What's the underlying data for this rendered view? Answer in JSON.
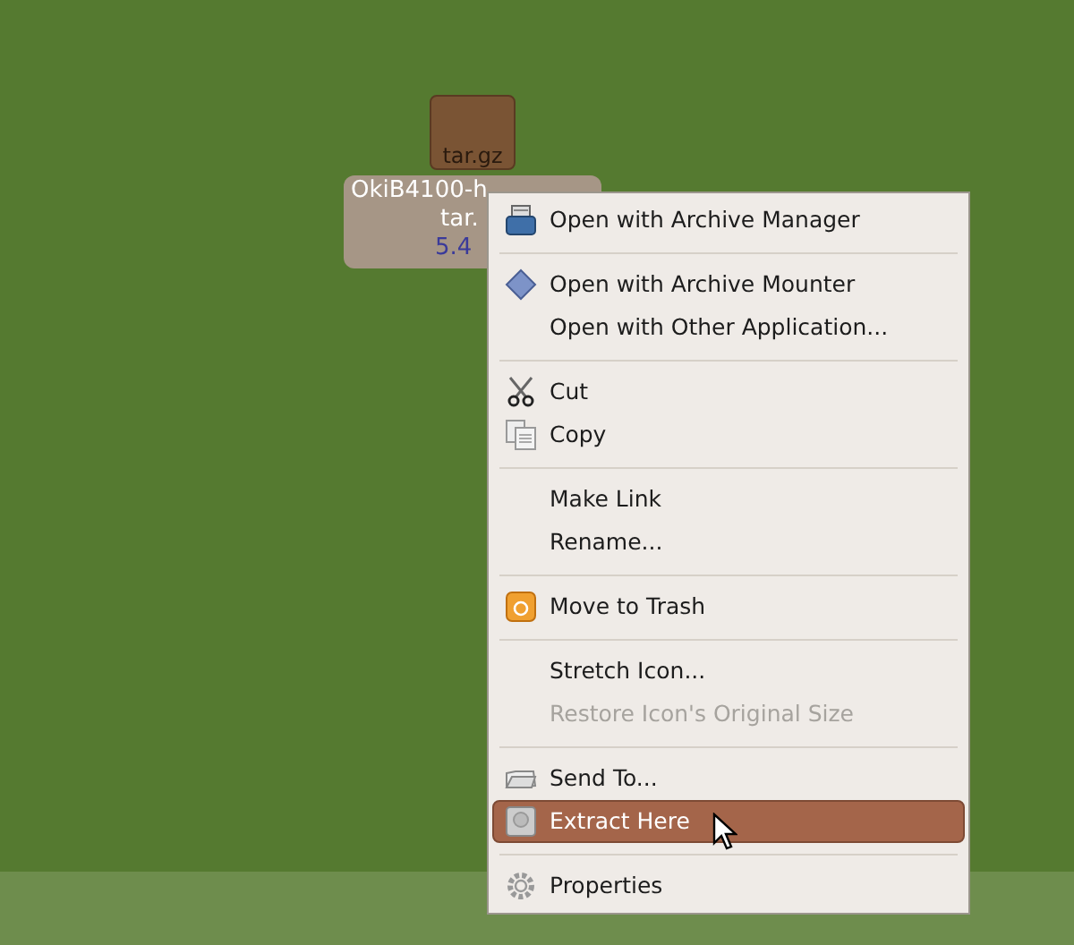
{
  "desktop_icon": {
    "badge": "tar.gz",
    "label_lines": [
      "OkiB4100-h",
      "tar.",
      "5.4"
    ],
    "selected": true
  },
  "context_menu": [
    {
      "kind": "item",
      "label": "Open with Archive Manager",
      "disabled": false,
      "selected": false
    },
    {
      "kind": "separator"
    },
    {
      "kind": "item",
      "label": "Open with Archive Mounter",
      "disabled": false,
      "selected": false
    },
    {
      "kind": "item",
      "label": "Open with Other Application...",
      "disabled": false,
      "selected": false
    },
    {
      "kind": "separator"
    },
    {
      "kind": "item",
      "label": "Cut",
      "disabled": false,
      "selected": false
    },
    {
      "kind": "item",
      "label": "Copy",
      "disabled": false,
      "selected": false
    },
    {
      "kind": "separator"
    },
    {
      "kind": "item",
      "label": "Make Link",
      "disabled": false,
      "selected": false
    },
    {
      "kind": "item",
      "label": "Rename...",
      "disabled": false,
      "selected": false
    },
    {
      "kind": "separator"
    },
    {
      "kind": "item",
      "label": "Move to Trash",
      "disabled": false,
      "selected": false
    },
    {
      "kind": "separator"
    },
    {
      "kind": "item",
      "label": "Stretch Icon...",
      "disabled": false,
      "selected": false
    },
    {
      "kind": "item",
      "label": "Restore Icon's Original Size",
      "disabled": true,
      "selected": false
    },
    {
      "kind": "separator"
    },
    {
      "kind": "item",
      "label": "Send To...",
      "disabled": false,
      "selected": false
    },
    {
      "kind": "item",
      "label": "Extract Here",
      "disabled": false,
      "selected": true
    },
    {
      "kind": "separator"
    },
    {
      "kind": "item",
      "label": "Properties",
      "disabled": false,
      "selected": false
    }
  ]
}
